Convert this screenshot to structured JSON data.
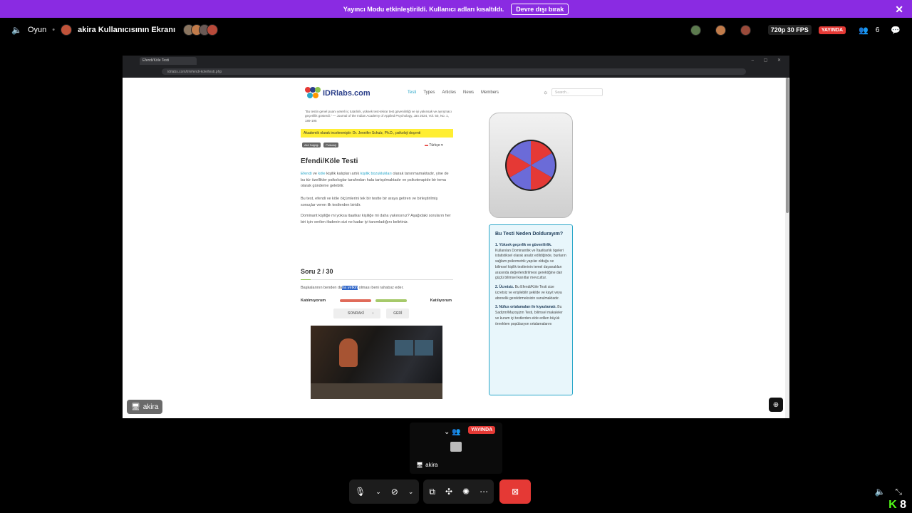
{
  "banner": {
    "text": "Yayıncı Modu etkinleştirildi. Kullanıcı adları kısaltıldı.",
    "button": "Devre dışı bırak",
    "close": "✕"
  },
  "topbar": {
    "channel_icon": "speaker-icon",
    "channel": "Oyun",
    "stream_title": "akira Kullanıcısının Ekranı",
    "quality": "720p 30 FPS",
    "live": "YAYINDA",
    "viewer_count": "6"
  },
  "browser": {
    "tab": "Efendi/Köle Testi",
    "url": "idrlabs.com/tr/efendi-kole/testi.php",
    "ctrls": "– ▢ ✕"
  },
  "site": {
    "logo": "IDRlabs.com",
    "nav": [
      "Testi",
      "Types",
      "Articles",
      "News",
      "Members"
    ],
    "search_placeholder": "Search..."
  },
  "article": {
    "quote": "\"Bu testin genel puanı yeterli iç tutarlılık, yüksek test-tekrar test güvenilirliği ve iyi yakınsak ve ayrışmacı geçerlilik gösterdi.\" — Journal of the Indian Academy of Applied Psychology, Jan 2024, Vol. 50, No. 1, 189-195",
    "endorse": "Akademik olarak incelenmiştir: Dr. Jennifer Schulz, Ph.D., psikoloji doçenti",
    "tags": [
      "Abil Sağlığı",
      "Psikoloji"
    ],
    "lang": "Türkçe",
    "title": "Efendi/Köle Testi",
    "p1_a": "Efendi",
    "p1_b": " ve ",
    "p1_c": "köle",
    "p1_d": " kişilik kalıpları artık ",
    "p1_e": "kişilik bozuklukları",
    "p1_f": " olarak tanınmamaktadır, yine de bu tür özellikler psikologlar tarafından hala tartışılmaktadır ve psikoterapide bir tema olarak gündeme gelebilir.",
    "p2": "Bu test, efendi ve köle ölçümlerini tek bir testte bir araya getiren ve birleştirilmiş sonuçlar veren ilk testlerden biridir.",
    "p3": "Dominant kişiliğe mi yoksa itaatkar kişiliğe mi daha yakınsınız? Aşağıdaki soruların her biri için verilen ifadenin sizi ne kadar iyi tanımladığını belirtiniz.",
    "question_label": "Soru 2 / 30",
    "question_a": "Başkalarının benden da",
    "question_hl": "ha yetkin",
    "question_b": " olması beni rahatsız eder.",
    "disagree": "Katılmıyorum",
    "agree": "Katılıyorum",
    "next": "SONRAKİ",
    "back": "GERİ"
  },
  "sidebar": {
    "title": "Bu Testi Neden Doldurayım?",
    "item1_title": "1. Yüksek geçerlik ve güvenilirlik.",
    "item1_body": " Kullanılan Dominantlık ve İtaatkarlık ögeleri istatistiksel olarak analiz edildiğinde, bunların sağlam psikometrik yapılar olduğu ve bilimsel kişilik testlerinin temel dayanakları arasında değerlendirilmesi gerektiğine dair güçlü bilimsel kanıtlar mevcuttur.",
    "item2_title": "2. Ücretsiz.",
    "item2_body": " Bu Efendi/Köle Testi size ücretsiz ve erişilebilir şekilde ve kayıt veya abonelik gerektirmeksizin sunulmaktadır.",
    "item3_title": "3. Nüfus ortalamaları ile kıyaslamalı.",
    "item3_body": " Bu Sadizm/Mazoşizm Testi, bilimsel makaleler ve kurum içi testlerden elde edilen büyük örneklem popülasyon ortalamalarını"
  },
  "stream": {
    "presenter": "akira",
    "live": "YAYINDA"
  },
  "kick": {
    "count": "8"
  },
  "colors": {
    "banner": "#8a2be2",
    "live": "#e53935",
    "accent": "#2aa7c9",
    "kick": "#53fc18"
  }
}
